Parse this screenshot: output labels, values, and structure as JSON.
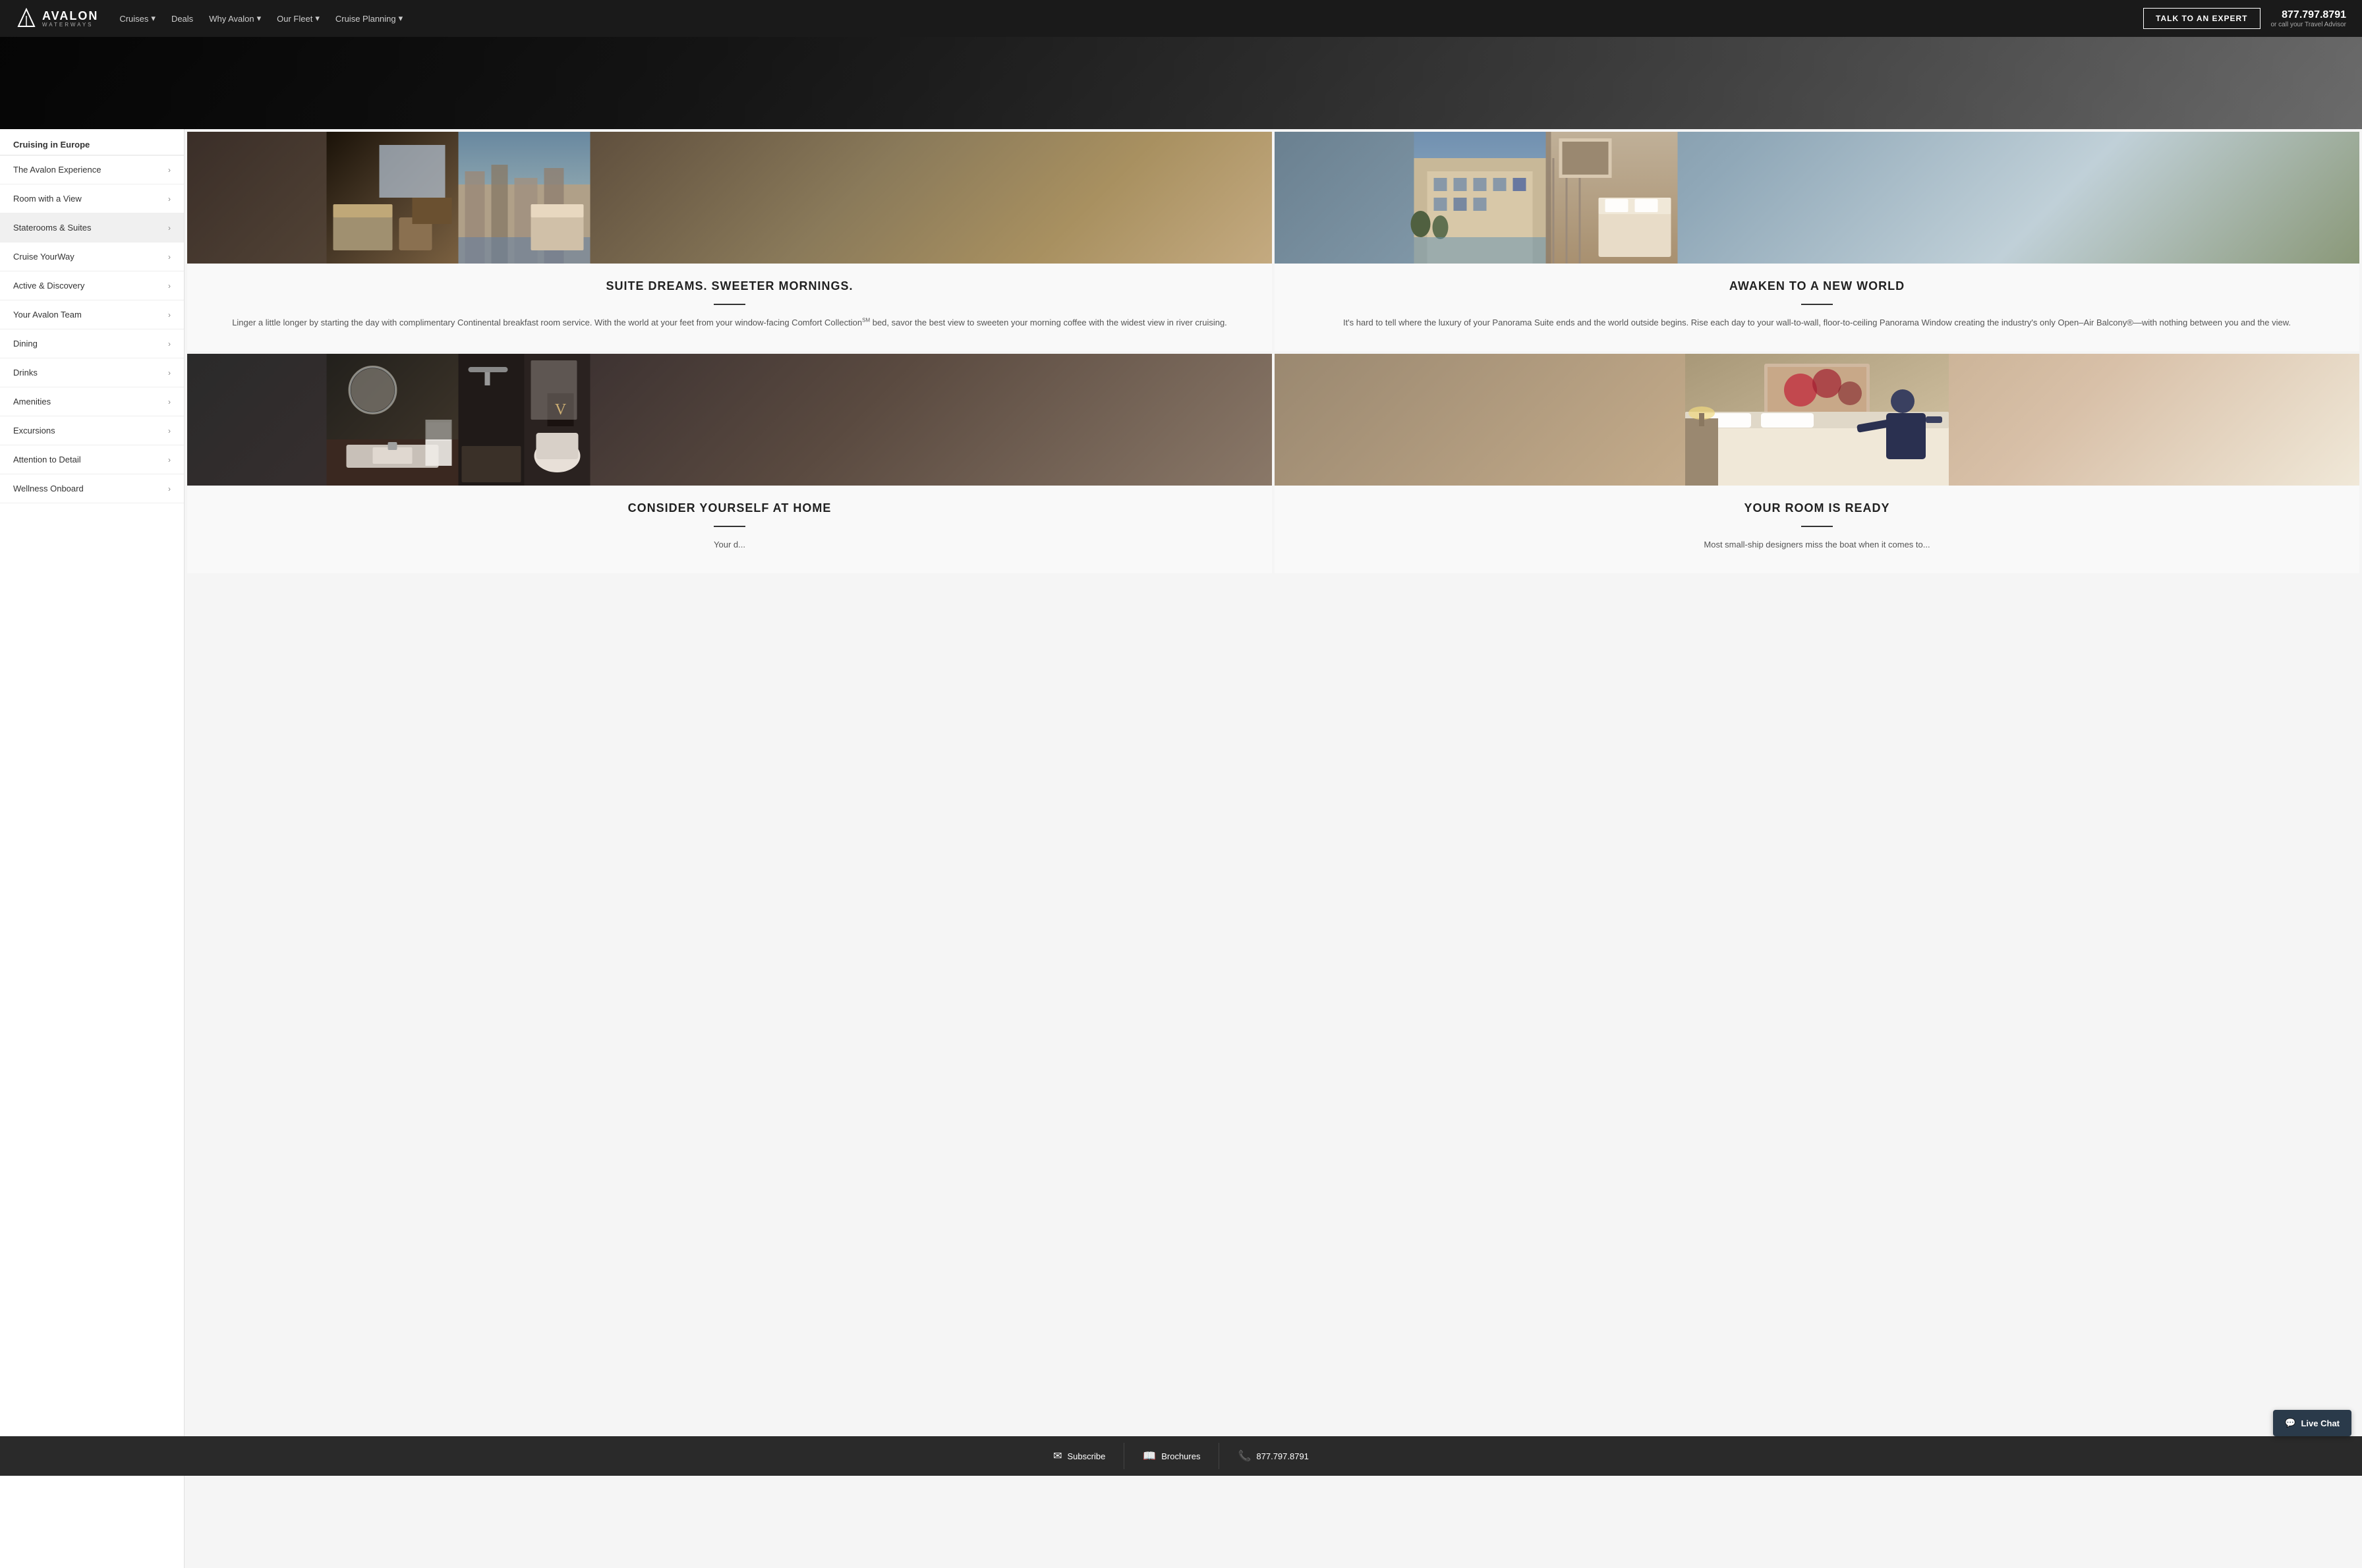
{
  "nav": {
    "logo": "AVALON",
    "logo_waterways": "WATERWAYS",
    "links": [
      {
        "label": "Cruises",
        "has_dropdown": true
      },
      {
        "label": "Deals",
        "has_dropdown": false
      },
      {
        "label": "Why Avalon",
        "has_dropdown": true
      },
      {
        "label": "Our Fleet",
        "has_dropdown": true
      },
      {
        "label": "Cruise Planning",
        "has_dropdown": true
      }
    ],
    "cta_button": "TALK TO AN EXPERT",
    "phone": "877.797.8791",
    "phone_sub": "or call your Travel Advisor"
  },
  "sidebar": {
    "category": "Cruising in Europe",
    "items": [
      {
        "label": "The Avalon Experience",
        "active": false
      },
      {
        "label": "Room with a View",
        "active": false
      },
      {
        "label": "Staterooms & Suites",
        "active": true
      },
      {
        "label": "Cruise YourWay",
        "active": false
      },
      {
        "label": "Active & Discovery",
        "active": false
      },
      {
        "label": "Your Avalon Team",
        "active": false
      },
      {
        "label": "Dining",
        "active": false
      },
      {
        "label": "Drinks",
        "active": false
      },
      {
        "label": "Amenities",
        "active": false
      },
      {
        "label": "Excursions",
        "active": false
      },
      {
        "label": "Attention to Detail",
        "active": false
      },
      {
        "label": "Wellness Onboard",
        "active": false
      }
    ]
  },
  "cards": [
    {
      "id": "suite-dreams",
      "title": "SUITE DREAMS. SWEETER MORNINGS.",
      "text": "Linger a little longer by starting the day with complimentary Continental breakfast room service. With the world at your feet from your window-facing Comfort Collectionˢᴹ bed, savor the best view to sweeten your morning coffee with the widest view in river cruising.",
      "image_type": "suite"
    },
    {
      "id": "awaken",
      "title": "AWAKEN TO A NEW WORLD",
      "text": "It’s hard to tell where the luxury of your Panorama Suite ends and the world outside begins. Rise each day to your wall-to-wall, floor-to-ceiling Panorama Window creating the industry’s only Open–Air Balcony®—with nothing between you and the view.",
      "image_type": "panorama"
    },
    {
      "id": "consider-home",
      "title": "CONSIDER YOURSELF AT HOME",
      "text": "Your d...",
      "image_type": "bathroom"
    },
    {
      "id": "room-ready",
      "title": "YOUR ROOM IS READY",
      "text": "Most small-ship designers miss the boat when it comes to...",
      "image_type": "bed"
    }
  ],
  "bottom_bar": {
    "subscribe_label": "Subscribe",
    "brochures_label": "Brochures",
    "phone_label": "877.797.8791"
  },
  "live_chat": {
    "label": "Live Chat"
  }
}
